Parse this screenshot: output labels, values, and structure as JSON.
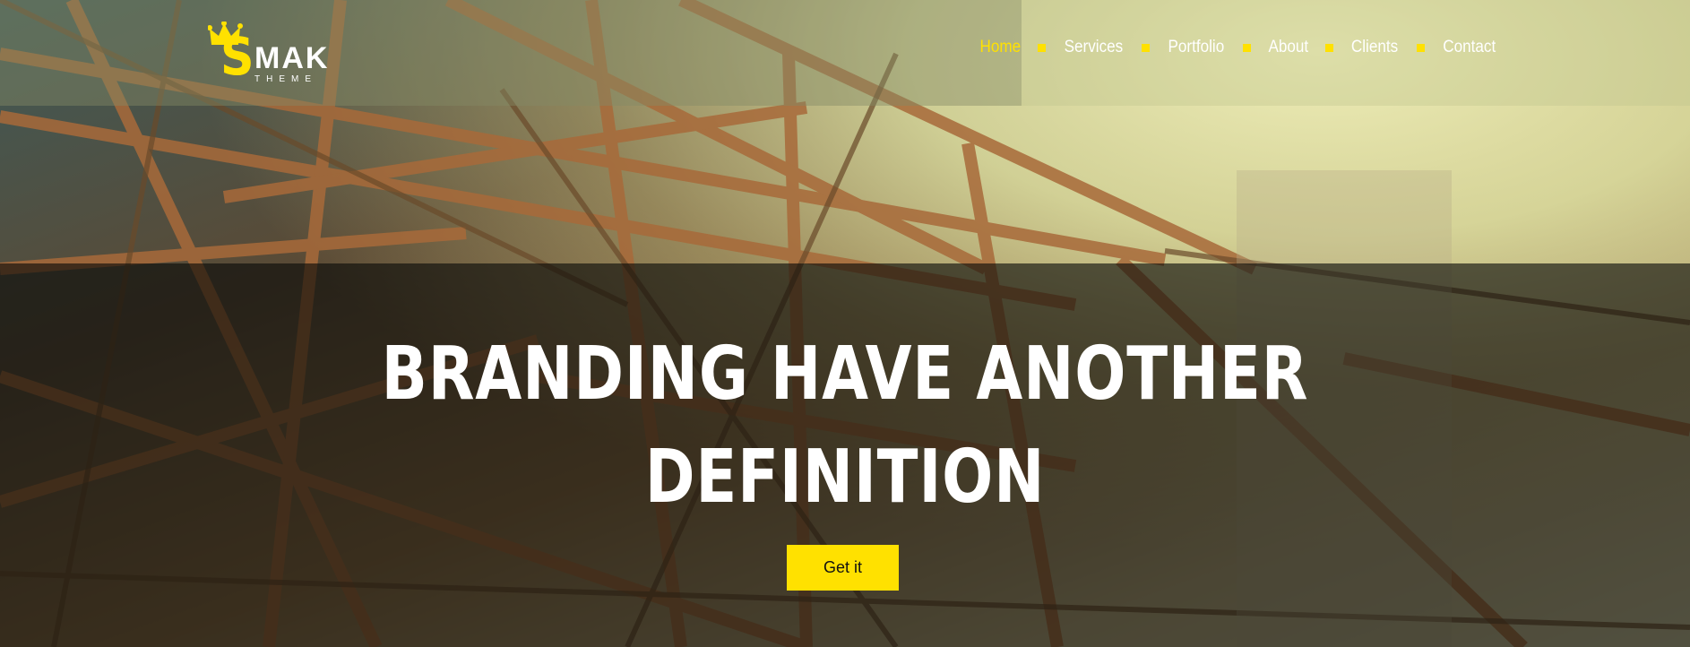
{
  "brand": {
    "logo_letter": "S",
    "logo_name": "MAK",
    "logo_tagline": "THEME",
    "accent_color": "#ffe100"
  },
  "nav": {
    "items": [
      {
        "label": "Home",
        "active": true
      },
      {
        "label": "Services",
        "active": false
      },
      {
        "label": "Portfolio",
        "active": false
      },
      {
        "label": "About",
        "active": false
      },
      {
        "label": "Clients",
        "active": false
      },
      {
        "label": "Contact",
        "active": false
      }
    ],
    "separator_icon": "square-bullet-icon"
  },
  "hero": {
    "headline_line1": "BRANDING HAVE ANOTHER",
    "headline_line2": "DEFINITION",
    "cta_label": "Get it",
    "background": "steel-bridge-photo"
  }
}
